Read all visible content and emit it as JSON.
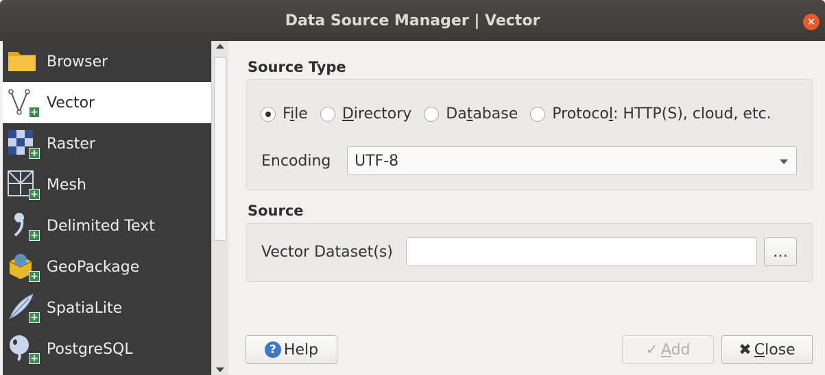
{
  "window": {
    "title": "Data Source Manager | Vector"
  },
  "sidebar": {
    "items": [
      {
        "label": "Browser",
        "icon": "folder-icon"
      },
      {
        "label": "Vector",
        "icon": "vector-icon",
        "selected": true
      },
      {
        "label": "Raster",
        "icon": "raster-icon"
      },
      {
        "label": "Mesh",
        "icon": "mesh-icon"
      },
      {
        "label": "Delimited Text",
        "icon": "delimited-text-icon"
      },
      {
        "label": "GeoPackage",
        "icon": "geopackage-icon"
      },
      {
        "label": "SpatiaLite",
        "icon": "spatialite-icon"
      },
      {
        "label": "PostgreSQL",
        "icon": "postgresql-icon"
      }
    ]
  },
  "source_type": {
    "title": "Source Type",
    "options": {
      "file": {
        "pre": "F",
        "u": "i",
        "post": "le"
      },
      "directory": {
        "pre": "",
        "u": "D",
        "post": "irectory"
      },
      "database": {
        "pre": "Da",
        "u": "t",
        "post": "abase"
      },
      "protocol": {
        "pre": "Protoco",
        "u": "l",
        "post": ": HTTP(S), cloud, etc."
      }
    },
    "selected": "File",
    "encoding_label": "Encoding",
    "encoding_value": "UTF-8"
  },
  "source": {
    "title": "Source",
    "dataset_label": "Vector Dataset(s)",
    "dataset_value": "",
    "browse_label": "…"
  },
  "buttons": {
    "help": "Help",
    "add": {
      "pre": "",
      "u": "A",
      "post": "dd"
    },
    "close": {
      "pre": "",
      "u": "C",
      "post": "lose"
    }
  }
}
